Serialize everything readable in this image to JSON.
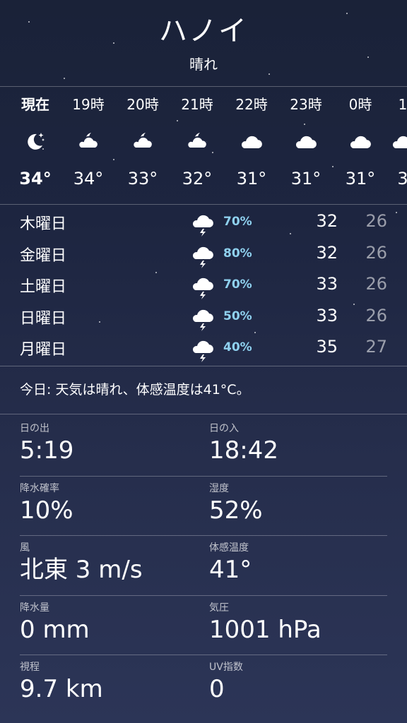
{
  "location": {
    "city": "ハノイ",
    "condition": "晴れ"
  },
  "hourly": [
    {
      "time": "現在",
      "icon": "moon-stars-icon",
      "temp": "34°",
      "now": true
    },
    {
      "time": "19時",
      "icon": "partly-cloudy-night-icon",
      "temp": "34°"
    },
    {
      "time": "20時",
      "icon": "partly-cloudy-night-icon",
      "temp": "33°"
    },
    {
      "time": "21時",
      "icon": "partly-cloudy-night-icon",
      "temp": "32°"
    },
    {
      "time": "22時",
      "icon": "cloud-icon",
      "temp": "31°"
    },
    {
      "time": "23時",
      "icon": "cloud-icon",
      "temp": "31°"
    },
    {
      "time": "0時",
      "icon": "cloud-icon",
      "temp": "31°"
    },
    {
      "time": "1",
      "icon": "cloud-icon",
      "temp": "3"
    }
  ],
  "daily": [
    {
      "day": "木曜日",
      "icon": "thunderstorm-icon",
      "pop": "70%",
      "high": "32",
      "low": "26"
    },
    {
      "day": "金曜日",
      "icon": "thunderstorm-icon",
      "pop": "80%",
      "high": "32",
      "low": "26"
    },
    {
      "day": "土曜日",
      "icon": "thunderstorm-icon",
      "pop": "70%",
      "high": "33",
      "low": "26"
    },
    {
      "day": "日曜日",
      "icon": "thunderstorm-icon",
      "pop": "50%",
      "high": "33",
      "low": "26"
    },
    {
      "day": "月曜日",
      "icon": "thunderstorm-icon",
      "pop": "40%",
      "high": "35",
      "low": "27"
    }
  ],
  "summary": "今日: 天気は晴れ、体感温度は41°C。",
  "details": [
    {
      "left": {
        "label": "日の出",
        "value": "5:19"
      },
      "right": {
        "label": "日の入",
        "value": "18:42"
      }
    },
    {
      "left": {
        "label": "降水確率",
        "value": "10%"
      },
      "right": {
        "label": "湿度",
        "value": "52%"
      }
    },
    {
      "left": {
        "label": "風",
        "value": "北東 3 m/s"
      },
      "right": {
        "label": "体感温度",
        "value": "41°"
      }
    },
    {
      "left": {
        "label": "降水量",
        "value": "0 mm"
      },
      "right": {
        "label": "気圧",
        "value": "1001 hPa"
      }
    },
    {
      "left": {
        "label": "視程",
        "value": "9.7 km"
      },
      "right": {
        "label": "UV指数",
        "value": "0"
      }
    }
  ],
  "colors": {
    "precip_accent": "#8fd1ef",
    "background_top": "#1a2238",
    "background_bottom": "#2c3557"
  }
}
